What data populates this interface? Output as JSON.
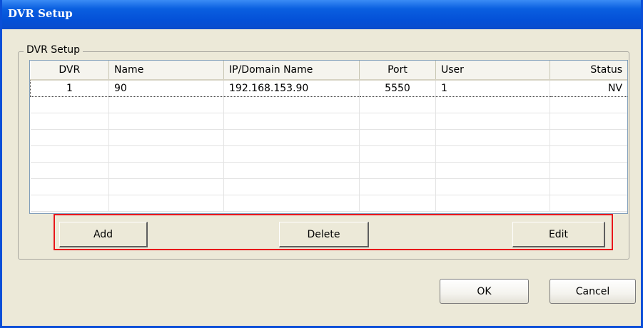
{
  "window": {
    "title": "DVR Setup"
  },
  "group": {
    "label": "DVR Setup"
  },
  "table": {
    "columns": [
      "DVR",
      "Name",
      "IP/Domain Name",
      "Port",
      "User",
      "Status"
    ],
    "rows": [
      [
        "1",
        "90",
        "192.168.153.90",
        "5550",
        "1",
        "NV"
      ]
    ]
  },
  "buttons": {
    "add": "Add",
    "delete": "Delete",
    "edit": "Edit",
    "ok": "OK",
    "cancel": "Cancel"
  },
  "colors": {
    "title_bar": "#0450d7",
    "highlight": "#e8161b",
    "dialog_bg": "#ece9d8"
  }
}
